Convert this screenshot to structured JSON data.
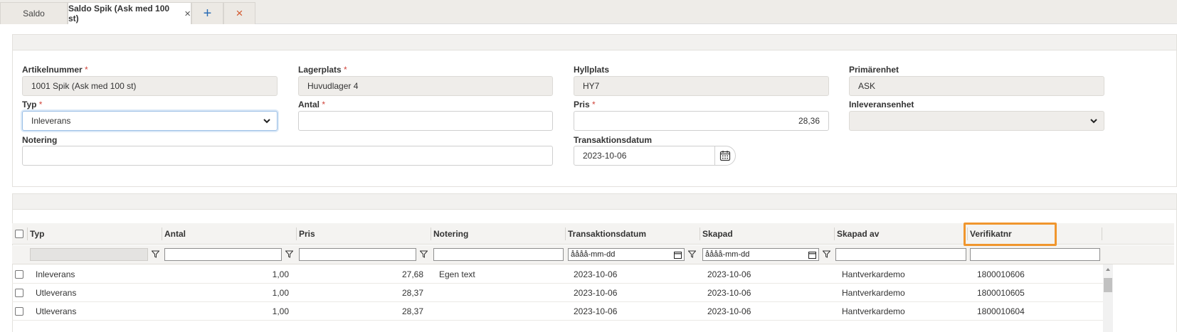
{
  "tabs": [
    {
      "label": "Saldo"
    },
    {
      "label": "Saldo Spik (Ask med 100 st)",
      "close": "×"
    }
  ],
  "tab_actions": {
    "add": "+",
    "close": "×"
  },
  "form": {
    "artikelnummer": {
      "label": "Artikelnummer",
      "value": "1001 Spik (Ask med 100 st)"
    },
    "lagerplats": {
      "label": "Lagerplats",
      "value": "Huvudlager 4"
    },
    "hyllplats": {
      "label": "Hyllplats",
      "value": "HY7"
    },
    "primarenhet": {
      "label": "Primärenhet",
      "value": "ASK"
    },
    "typ": {
      "label": "Typ",
      "value": "Inleverans"
    },
    "antal": {
      "label": "Antal",
      "value": ""
    },
    "pris": {
      "label": "Pris",
      "value": "28,36"
    },
    "inleveransenhet": {
      "label": "Inleveransenhet",
      "value": ""
    },
    "notering": {
      "label": "Notering",
      "value": ""
    },
    "transaktionsdatum": {
      "label": "Transaktionsdatum",
      "value": "2023-10-06"
    },
    "required_mark": "*"
  },
  "grid": {
    "columns": [
      "Typ",
      "Antal",
      "Pris",
      "Notering",
      "Transaktionsdatum",
      "Skapad",
      "Skapad av",
      "Verifikatnr"
    ],
    "date_placeholder": "åååå-mm-dd",
    "rows": [
      {
        "typ": "Inleverans",
        "antal": "1,00",
        "pris": "27,68",
        "notering": "Egen text",
        "transaktionsdatum": "2023-10-06",
        "skapad": "2023-10-06",
        "skapad_av": "Hantverkardemo",
        "verifikatnr": "1800010606"
      },
      {
        "typ": "Utleverans",
        "antal": "1,00",
        "pris": "28,37",
        "notering": "",
        "transaktionsdatum": "2023-10-06",
        "skapad": "2023-10-06",
        "skapad_av": "Hantverkardemo",
        "verifikatnr": "1800010605"
      },
      {
        "typ": "Utleverans",
        "antal": "1,00",
        "pris": "28,37",
        "notering": "",
        "transaktionsdatum": "2023-10-06",
        "skapad": "2023-10-06",
        "skapad_av": "Hantverkardemo",
        "verifikatnr": "1800010604"
      }
    ]
  },
  "colors": {
    "accent_highlight": "#f0962e",
    "required": "#d0443a",
    "add": "#2a6cb5",
    "close": "#d2552a"
  }
}
